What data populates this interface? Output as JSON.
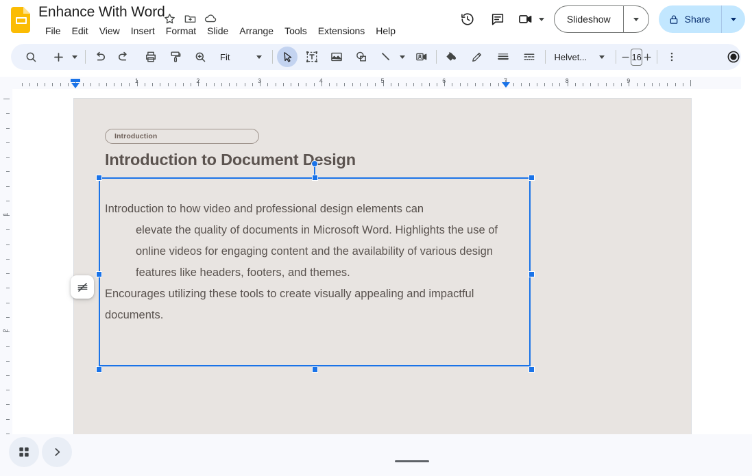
{
  "header": {
    "doc_title": "Enhance With Word",
    "logo_icon": "google-slides-logo",
    "title_icons": [
      {
        "name": "star-icon",
        "glyph": "star"
      },
      {
        "name": "move-to-folder-icon",
        "glyph": "folder-move"
      },
      {
        "name": "cloud-saved-icon",
        "glyph": "cloud"
      }
    ],
    "menus": [
      "File",
      "Edit",
      "View",
      "Insert",
      "Format",
      "Slide",
      "Arrange",
      "Tools",
      "Extensions",
      "Help"
    ],
    "right_icons": [
      {
        "name": "version-history-icon",
        "glyph": "history"
      },
      {
        "name": "comment-icon",
        "glyph": "comment"
      },
      {
        "name": "meet-camera-icon",
        "glyph": "camera"
      }
    ],
    "slideshow_label": "Slideshow",
    "share_label": "Share",
    "share_lock_icon": "lock-icon",
    "share_color": "#c2e7ff",
    "share_text_color": "#062e6f"
  },
  "toolbar": {
    "items": [
      {
        "name": "search-icon",
        "label": ""
      },
      {
        "name": "new-slide-icon",
        "label": ""
      },
      {
        "name": "undo-icon",
        "label": ""
      },
      {
        "name": "redo-icon",
        "label": ""
      },
      {
        "name": "print-icon",
        "label": ""
      },
      {
        "name": "paint-format-icon",
        "label": ""
      },
      {
        "name": "zoom-icon",
        "label": ""
      },
      {
        "name": "select-cursor-icon",
        "label": ""
      },
      {
        "name": "text-box-icon",
        "label": ""
      },
      {
        "name": "insert-image-icon",
        "label": ""
      },
      {
        "name": "shape-icon",
        "label": ""
      },
      {
        "name": "line-icon",
        "label": ""
      },
      {
        "name": "insert-video-icon",
        "label": ""
      },
      {
        "name": "fill-color-icon",
        "label": ""
      },
      {
        "name": "border-color-icon",
        "label": ""
      },
      {
        "name": "border-weight-icon",
        "label": ""
      },
      {
        "name": "border-dash-icon",
        "label": ""
      },
      {
        "name": "more-options-icon",
        "label": ""
      },
      {
        "name": "present-record-icon",
        "label": ""
      },
      {
        "name": "collapse-toolbar-icon",
        "label": ""
      }
    ],
    "zoom_value": "Fit",
    "font_name": "Helvet...",
    "font_size": "16",
    "decrease_font_label": "−",
    "increase_font_label": "+"
  },
  "rulers": {
    "horizontal_numbers": [
      "1",
      "2",
      "3",
      "4",
      "5",
      "6",
      "7",
      "8",
      "9"
    ],
    "vertical_numbers": [
      "1",
      "2"
    ],
    "left_indent_position": "0",
    "right_indent_position": "7",
    "marker_color": "#1a73e8"
  },
  "slide": {
    "background": "#e8e4e1",
    "chip_label": "Introduction",
    "chip_border_color": "#9e938c",
    "title": "Introduction to Document Design",
    "title_color": "#5b534f",
    "body_line1": "Introduction to how video and professional design elements can",
    "body_indent": "elevate the quality of documents in Microsoft Word. Highlights the use of online videos for engaging content and the availability of various design features like headers, footers, and themes.",
    "body_line5": "Encourages utilizing these tools to create visually appealing and impactful documents.",
    "body_color": "#59524e",
    "selection_color": "#1a73e8",
    "float_button_icon": "no-border-icon"
  },
  "bottom": {
    "grid_view_icon": "grid-view-icon",
    "expand_panel_icon": "chevron-right-icon",
    "drag_handle_name": "panel-drag-handle"
  }
}
